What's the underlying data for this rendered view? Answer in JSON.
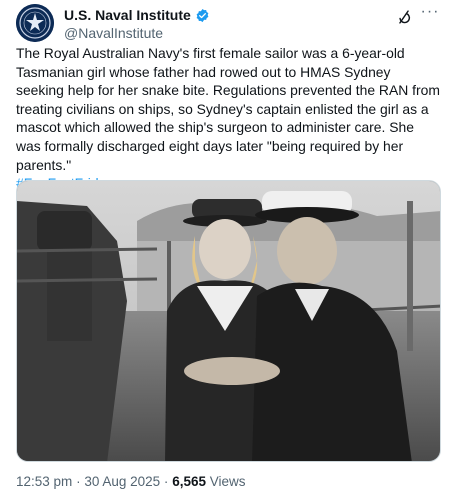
{
  "account": {
    "display_name": "U.S. Naval Institute",
    "handle": "@NavalInstitute",
    "verified": true
  },
  "tweet": {
    "text": "The Royal Australian Navy's first female sailor was a 6-year-old Tasmanian girl whose father had rowed out to HMAS Sydney seeking help for her snake bite. Regulations prevented the RAN from treating civilians on ships, so Sydney's captain enlisted the girl as a mascot which allowed the ship's surgeon to administer care. She was formally discharged eight days later \"being required by her parents.\"",
    "hashtag": "#FunFactFriday"
  },
  "media": {
    "type": "photo",
    "description_icon": "photo-icon"
  },
  "meta": {
    "time": "12:53 pm",
    "separator": "·",
    "date": "30 Aug 2025",
    "views_count": "6,565",
    "views_label": "Views"
  },
  "colors": {
    "accent": "#1d9bf0",
    "text": "#0f1419",
    "secondary": "#536471"
  }
}
